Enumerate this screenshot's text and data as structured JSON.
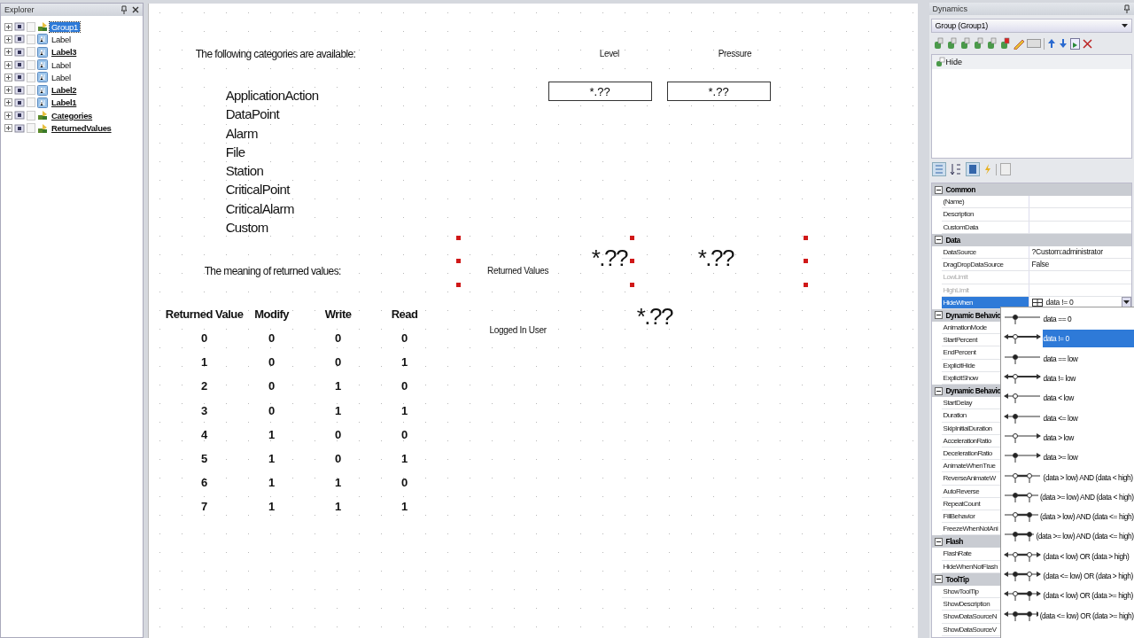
{
  "explorer": {
    "title": "Explorer",
    "items": [
      {
        "label": "Group1",
        "kind": "group",
        "selected": true,
        "linked": false
      },
      {
        "label": "Label",
        "kind": "label",
        "selected": false,
        "linked": false
      },
      {
        "label": "Label3",
        "kind": "label",
        "selected": false,
        "linked": true
      },
      {
        "label": "Label",
        "kind": "label",
        "selected": false,
        "linked": false
      },
      {
        "label": "Label",
        "kind": "label",
        "selected": false,
        "linked": false
      },
      {
        "label": "Label2",
        "kind": "label",
        "selected": false,
        "linked": true
      },
      {
        "label": "Label1",
        "kind": "label",
        "selected": false,
        "linked": true
      },
      {
        "label": "Categories",
        "kind": "group",
        "selected": false,
        "linked": true
      },
      {
        "label": "ReturnedValues",
        "kind": "group",
        "selected": false,
        "linked": true
      }
    ]
  },
  "canvas": {
    "intro": "The following categories are available:",
    "categories": [
      "ApplicationAction",
      "DataPoint",
      "Alarm",
      "File",
      "Station",
      "CriticalPoint",
      "CriticalAlarm",
      "Custom"
    ],
    "meaning_label": "The meaning of returned values:",
    "table": {
      "columns": [
        "Returned Value",
        "Modify",
        "Write",
        "Read"
      ],
      "rows": [
        [
          "0",
          "0",
          "0",
          "0"
        ],
        [
          "1",
          "0",
          "0",
          "1"
        ],
        [
          "2",
          "0",
          "1",
          "0"
        ],
        [
          "3",
          "0",
          "1",
          "1"
        ],
        [
          "4",
          "1",
          "0",
          "0"
        ],
        [
          "5",
          "1",
          "0",
          "1"
        ],
        [
          "6",
          "1",
          "1",
          "0"
        ],
        [
          "7",
          "1",
          "1",
          "1"
        ]
      ]
    },
    "gauges": [
      {
        "label": "Level",
        "value": "*.??"
      },
      {
        "label": "Pressure",
        "value": "*.??"
      }
    ],
    "returned_values": {
      "label": "Returned Values",
      "values": [
        "*.??",
        "*.??"
      ],
      "selected": true
    },
    "logged_in_user": {
      "label": "Logged In User",
      "value": "*.??"
    }
  },
  "dynamics": {
    "title": "Dynamics",
    "object": "Group (Group1)",
    "behaviors": [
      "Hide"
    ],
    "property_grid": [
      {
        "name": "Common",
        "expanded": true,
        "properties": [
          {
            "name": "(Name)",
            "disabled": false,
            "selected": false
          },
          {
            "name": "Description",
            "disabled": false,
            "selected": false
          },
          {
            "name": "CustomData",
            "disabled": false,
            "selected": false
          }
        ]
      },
      {
        "name": "Data",
        "expanded": true,
        "properties": [
          {
            "name": "DataSource",
            "value": "?Custom:administrator",
            "disabled": false,
            "selected": false
          },
          {
            "name": "DragDropDataSource",
            "value": "False",
            "disabled": false,
            "selected": false
          },
          {
            "name": "LowLimit",
            "disabled": true,
            "selected": false
          },
          {
            "name": "HighLimit",
            "disabled": true,
            "selected": false
          },
          {
            "name": "HideWhen",
            "value": "data != 0",
            "disabled": false,
            "selected": true
          }
        ]
      },
      {
        "name": "Dynamic Behavio",
        "expanded": true,
        "properties": [
          {
            "name": "AnimationMode",
            "disabled": false,
            "selected": false
          },
          {
            "name": "StartPercent",
            "disabled": false,
            "selected": false
          },
          {
            "name": "EndPercent",
            "disabled": false,
            "selected": false
          },
          {
            "name": "ExplicitHide",
            "disabled": false,
            "selected": false
          },
          {
            "name": "ExplicitShow",
            "disabled": false,
            "selected": false
          }
        ]
      },
      {
        "name": "Dynamic Behavio",
        "expanded": true,
        "properties": [
          {
            "name": "StartDelay",
            "disabled": false,
            "selected": false
          },
          {
            "name": "Duration",
            "disabled": false,
            "selected": false
          },
          {
            "name": "SkipInitialDuration",
            "disabled": false,
            "selected": false
          },
          {
            "name": "AccelerationRatio",
            "disabled": false,
            "selected": false
          },
          {
            "name": "DecelerationRatio",
            "disabled": false,
            "selected": false
          },
          {
            "name": "AnimateWhenTrue",
            "disabled": false,
            "selected": false
          },
          {
            "name": "ReverseAnimateW",
            "disabled": false,
            "selected": false
          },
          {
            "name": "AutoReverse",
            "disabled": false,
            "selected": false
          },
          {
            "name": "RepeatCount",
            "disabled": false,
            "selected": false
          },
          {
            "name": "FillBehavior",
            "disabled": false,
            "selected": false
          },
          {
            "name": "FreezeWhenNotAni",
            "disabled": false,
            "selected": false
          }
        ]
      },
      {
        "name": "Flash",
        "expanded": true,
        "properties": [
          {
            "name": "FlashRate",
            "disabled": false,
            "selected": false
          },
          {
            "name": "HideWhenNotFlash",
            "disabled": false,
            "selected": false
          }
        ]
      },
      {
        "name": "ToolTip",
        "expanded": true,
        "properties": [
          {
            "name": "ShowToolTip",
            "disabled": false,
            "selected": false
          },
          {
            "name": "ShowDescription",
            "disabled": false,
            "selected": false
          },
          {
            "name": "ShowDataSourceN",
            "disabled": false,
            "selected": false
          },
          {
            "name": "ShowDataSourceV",
            "disabled": false,
            "selected": false
          }
        ]
      }
    ],
    "dropdown_options": [
      {
        "label": "data == 0",
        "selected": false
      },
      {
        "label": "data != 0",
        "selected": true
      },
      {
        "label": "data == low",
        "selected": false
      },
      {
        "label": "data != low",
        "selected": false
      },
      {
        "label": "data < low",
        "selected": false
      },
      {
        "label": "data <= low",
        "selected": false
      },
      {
        "label": "data > low",
        "selected": false
      },
      {
        "label": "data >= low",
        "selected": false
      },
      {
        "label": "(data > low) AND (data < high)",
        "selected": false
      },
      {
        "label": "(data >= low) AND (data < high)",
        "selected": false
      },
      {
        "label": "(data > low) AND (data <= high)",
        "selected": false
      },
      {
        "label": "(data >= low) AND (data <= high)",
        "selected": false
      },
      {
        "label": "(data < low) OR (data > high)",
        "selected": false
      },
      {
        "label": "(data <= low) OR (data > high)",
        "selected": false
      },
      {
        "label": "(data < low) OR (data >= high)",
        "selected": false
      },
      {
        "label": "(data <= low) OR (data >= high)",
        "selected": false
      }
    ]
  }
}
